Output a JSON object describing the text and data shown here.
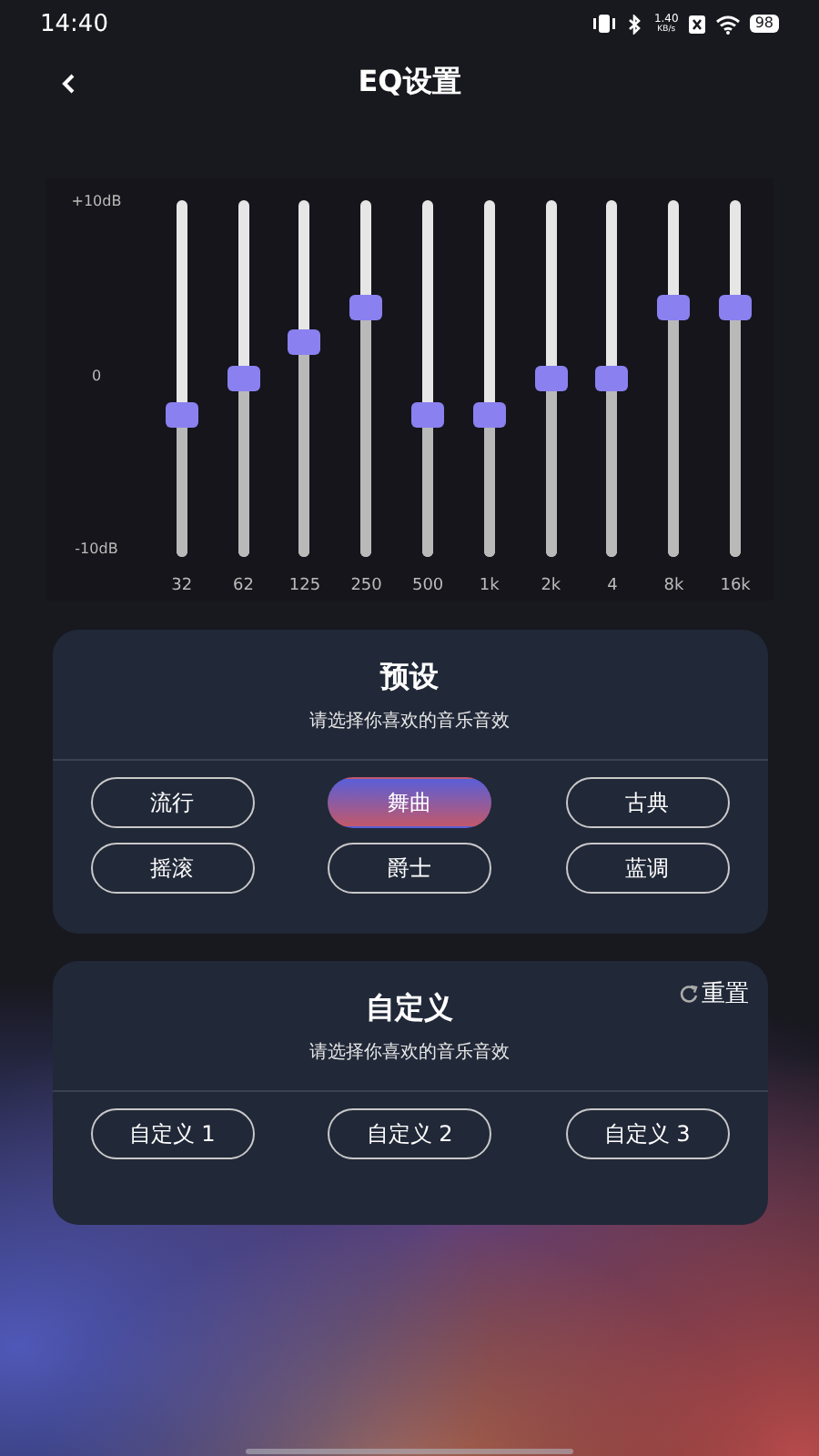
{
  "status_bar": {
    "time": "14:40",
    "speed_value": "1.40",
    "speed_unit": "KB/s",
    "battery": "98"
  },
  "header": {
    "title": "EQ设置"
  },
  "equalizer": {
    "scale": [
      "+10dB",
      "0",
      "-10dB"
    ],
    "bands": [
      {
        "label": "32",
        "level": 0.4
      },
      {
        "label": "62",
        "level": 0.5
      },
      {
        "label": "125",
        "level": 0.6
      },
      {
        "label": "250",
        "level": 0.7
      },
      {
        "label": "500",
        "level": 0.4
      },
      {
        "label": "1k",
        "level": 0.4
      },
      {
        "label": "2k",
        "level": 0.5
      },
      {
        "label": "4",
        "level": 0.5
      },
      {
        "label": "8k",
        "level": 0.7
      },
      {
        "label": "16k",
        "level": 0.7
      }
    ]
  },
  "presets": {
    "title": "预设",
    "subtitle": "请选择你喜欢的音乐音效",
    "options": [
      {
        "label": "流行",
        "selected": false
      },
      {
        "label": "舞曲",
        "selected": true
      },
      {
        "label": "古典",
        "selected": false
      },
      {
        "label": "摇滚",
        "selected": false
      },
      {
        "label": "爵士",
        "selected": false
      },
      {
        "label": "蓝调",
        "selected": false
      }
    ]
  },
  "custom": {
    "title": "自定义",
    "subtitle": "请选择你喜欢的音乐音效",
    "reset": "重置",
    "options": [
      {
        "label": "自定义 1",
        "selected": false
      },
      {
        "label": "自定义 2",
        "selected": false
      },
      {
        "label": "自定义 3",
        "selected": false
      }
    ]
  }
}
